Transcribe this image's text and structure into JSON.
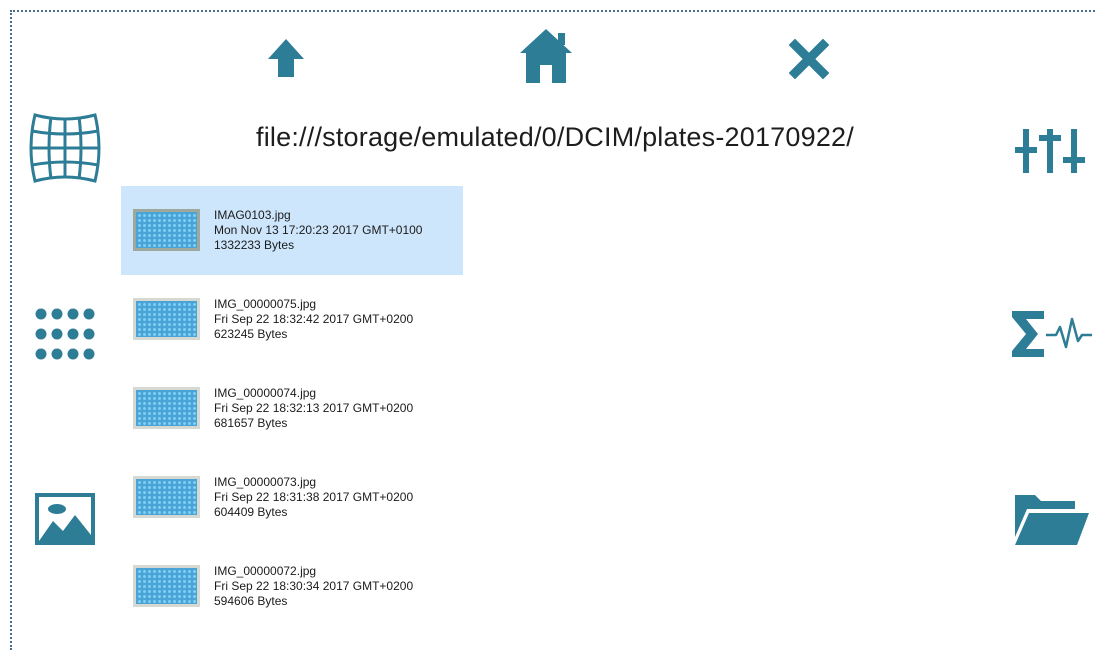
{
  "toolbar": {
    "up_icon": "arrow-up-icon",
    "home_icon": "home-icon",
    "close_icon": "close-icon"
  },
  "left_panel": {
    "grid_icon": "grid-warp-icon",
    "dots_icon": "dot-matrix-icon",
    "image_icon": "image-icon"
  },
  "right_panel": {
    "sliders_icon": "sliders-icon",
    "sum_icon": "sum-signal-icon",
    "folder_icon": "folder-open-icon"
  },
  "path": "file:///storage/emulated/0/DCIM/plates-20170922/",
  "colors": {
    "accent": "#2e7d97",
    "selected_row": "#cde6fb",
    "frame_border": "#4a6b8a"
  },
  "files": [
    {
      "name": "IMAG0103.jpg",
      "date": "Mon Nov 13 17:20:23 2017 GMT+0100",
      "size": "1332233 Bytes",
      "selected": true
    },
    {
      "name": "IMG_00000075.jpg",
      "date": "Fri Sep 22 18:32:42 2017 GMT+0200",
      "size": "623245 Bytes",
      "selected": false
    },
    {
      "name": "IMG_00000074.jpg",
      "date": "Fri Sep 22 18:32:13 2017 GMT+0200",
      "size": "681657 Bytes",
      "selected": false
    },
    {
      "name": "IMG_00000073.jpg",
      "date": "Fri Sep 22 18:31:38 2017 GMT+0200",
      "size": "604409 Bytes",
      "selected": false
    },
    {
      "name": "IMG_00000072.jpg",
      "date": "Fri Sep 22 18:30:34 2017 GMT+0200",
      "size": "594606 Bytes",
      "selected": false
    }
  ]
}
